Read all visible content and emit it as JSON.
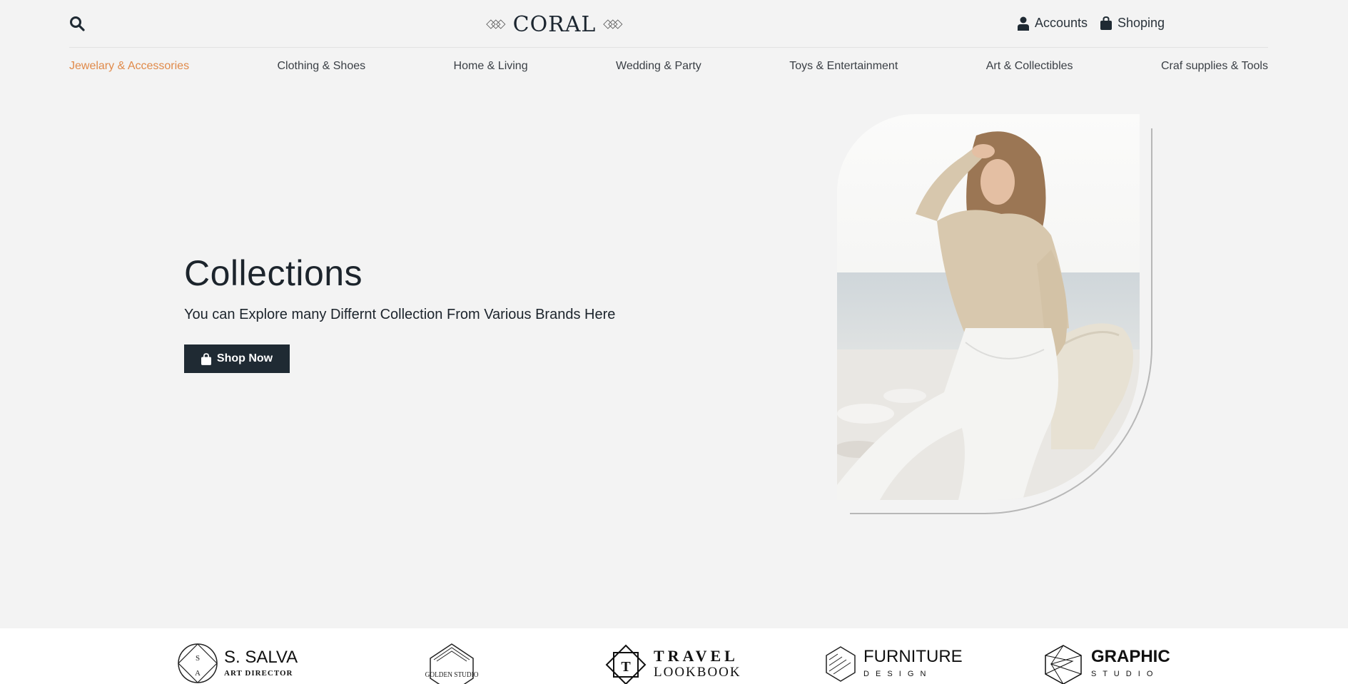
{
  "header": {
    "logo_text": "CORAL",
    "accounts_label": "Accounts",
    "shopping_label": "Shoping"
  },
  "nav": {
    "items": [
      {
        "label": "Jewelary & Accessories",
        "active": true
      },
      {
        "label": "Clothing & Shoes"
      },
      {
        "label": "Home & Living"
      },
      {
        "label": "Wedding & Party"
      },
      {
        "label": "Toys & Entertainment"
      },
      {
        "label": "Art & Collectibles"
      },
      {
        "label": "Craf supplies & Tools"
      }
    ]
  },
  "hero": {
    "title": "Collections",
    "subtitle": "You can Explore many Differnt Collection From Various Brands Here",
    "button_label": "Shop Now"
  },
  "brands": [
    {
      "name": "S. SALVA",
      "sub": "ART DIRECTOR",
      "monogram_top": "S",
      "monogram_bottom": "A"
    },
    {
      "name": "GOLDEN STUDIO"
    },
    {
      "name": "TRAVEL",
      "sub": "LOOKBOOK",
      "mark": "T"
    },
    {
      "name": "FURNITURE",
      "sub": "D E S I G N"
    },
    {
      "name": "GRAPHIC",
      "sub": "S T U D I O"
    }
  ],
  "colors": {
    "accent": "#e08a4a",
    "dark": "#1f2a33",
    "background": "#f3f3f3"
  },
  "icons": {
    "search": "search-icon",
    "account": "user-icon",
    "shopping": "bag-icon"
  }
}
